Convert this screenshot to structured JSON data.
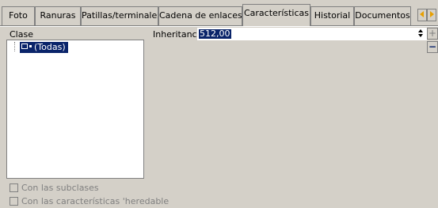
{
  "tabs": [
    {
      "label": "Foto",
      "active": false
    },
    {
      "label": "Ranuras",
      "active": false
    },
    {
      "label": "Patillas/terminales",
      "active": false
    },
    {
      "label": "Cadena de enlaces",
      "active": false
    },
    {
      "label": "Características",
      "active": true
    },
    {
      "label": "Historial",
      "active": false
    },
    {
      "label": "Documentos",
      "active": false
    }
  ],
  "left_panel": {
    "label": "Clase",
    "tree_item": "(Todas)",
    "checkbox_subclases": "Con las subclases",
    "checkbox_heredables": "Con las características 'heredable"
  },
  "right_panel": {
    "inheritance_label": "Inheritance:",
    "inheritance_value": "512,00"
  },
  "buttons": {
    "add": "+",
    "remove": "−"
  },
  "colors": {
    "window_bg": "#d4d0c8",
    "selection": "#0a246a",
    "scroll_arrow": "#e8a000"
  }
}
